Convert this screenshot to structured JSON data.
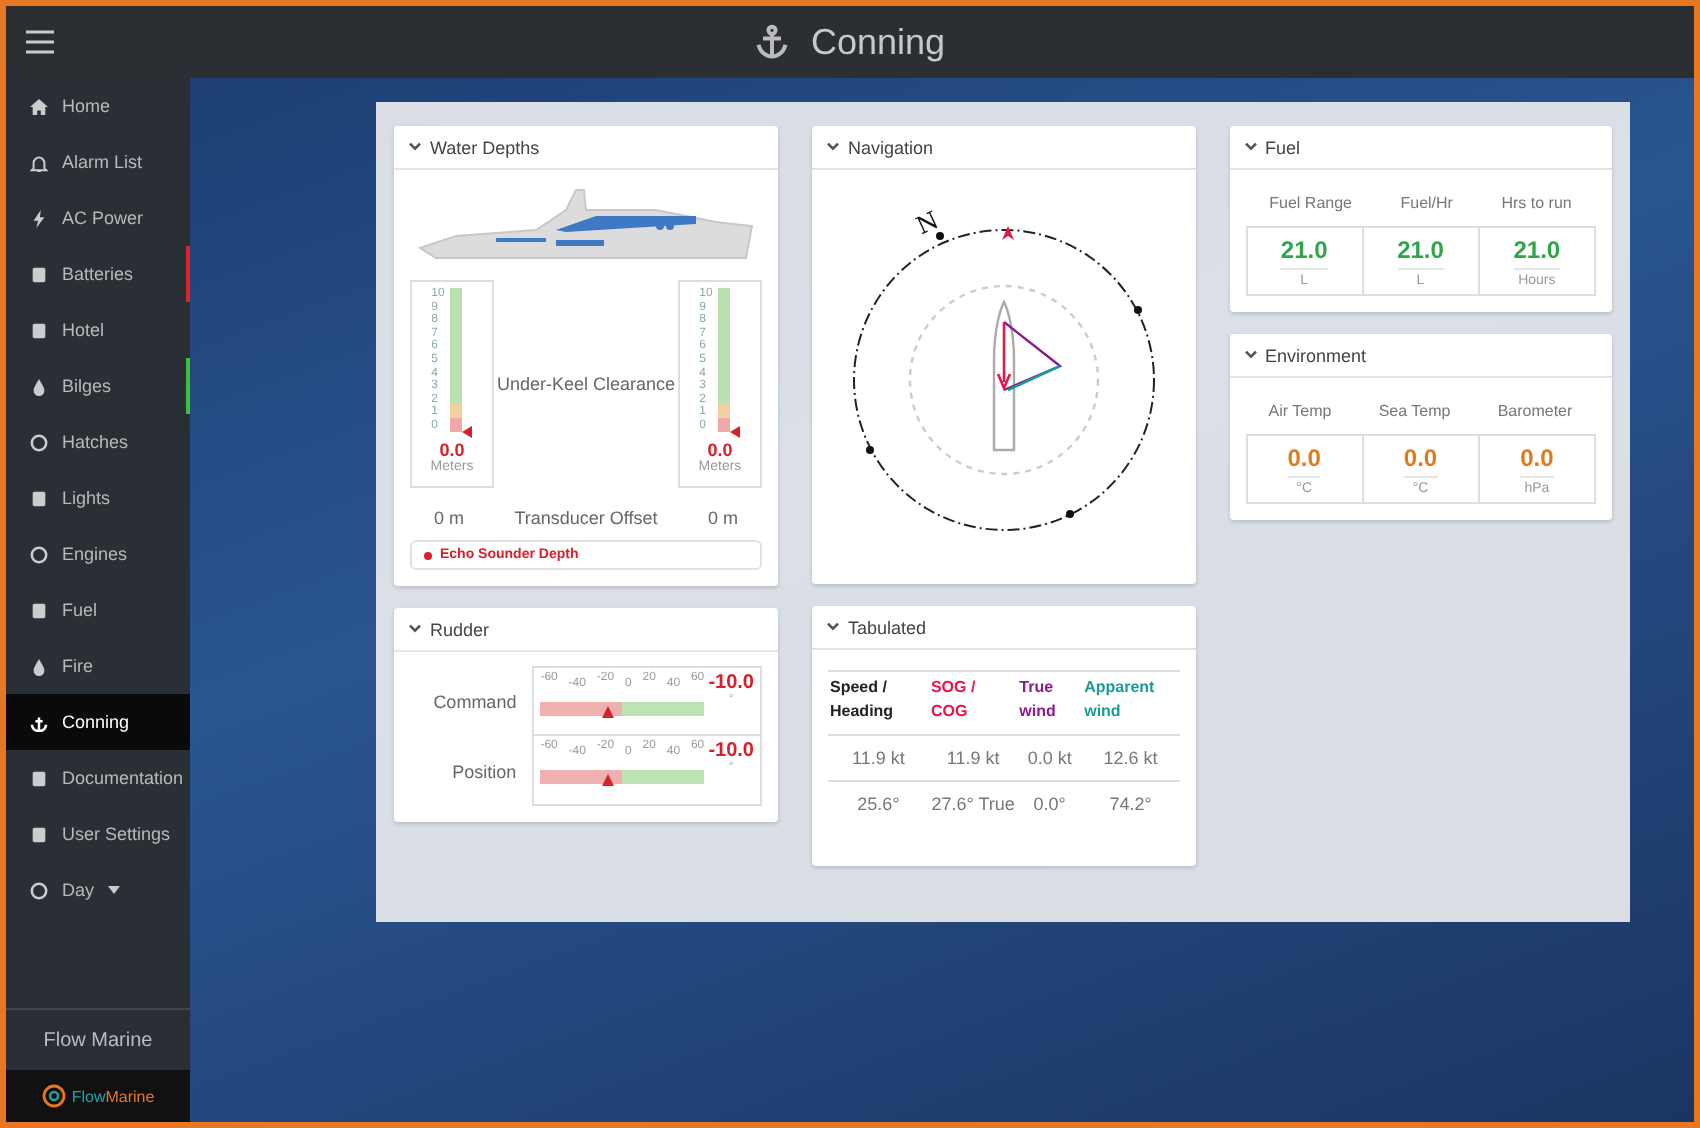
{
  "window": {
    "title": "Conning"
  },
  "sidebar": {
    "items": [
      {
        "label": "Home",
        "selected": false
      },
      {
        "label": "Alarm List",
        "selected": false
      },
      {
        "label": "AC Power",
        "selected": false
      },
      {
        "label": "Batteries",
        "selected": false,
        "color": "#e0202a"
      },
      {
        "label": "Hotel",
        "selected": false
      },
      {
        "label": "Bilges",
        "selected": false,
        "color": "#39c13a"
      },
      {
        "label": "Hatches",
        "selected": false
      },
      {
        "label": "Lights",
        "selected": false
      },
      {
        "label": "Engines",
        "selected": false
      },
      {
        "label": "Fuel",
        "selected": false
      },
      {
        "label": "Fire",
        "selected": false
      },
      {
        "label": "Conning",
        "selected": true
      },
      {
        "label": "Documentation",
        "selected": false
      },
      {
        "label": "User Settings",
        "selected": false
      },
      {
        "label": "Day",
        "selected": false,
        "dropdown": true
      }
    ],
    "footer": "Flow Marine",
    "logo": [
      {
        "text": "Flow",
        "color": "#1fa3a8"
      },
      {
        "text": "Marine",
        "color": "#e87722"
      }
    ]
  },
  "water_depths": {
    "title": "Water Depths",
    "center_label": "Under-Keel Clearance",
    "gauges": [
      {
        "scale": [
          "10",
          "9",
          "8",
          "7",
          "6",
          "5",
          "4",
          "3",
          "2",
          "1",
          "0"
        ],
        "level": 0,
        "value": "0.0",
        "unit": "Meters"
      },
      {
        "scale": [
          "10",
          "9",
          "8",
          "7",
          "6",
          "5",
          "4",
          "3",
          "2",
          "1",
          "0"
        ],
        "level": 0,
        "value": "0.0",
        "unit": "Meters"
      }
    ],
    "offset": {
      "left": "0 m",
      "label": "Transducer Offset",
      "right": "0 m"
    },
    "legend": {
      "label": "Echo Sounder Depth",
      "color": "#d8202a"
    }
  },
  "rudder": {
    "title": "Rudder",
    "rows": [
      {
        "label": "Command",
        "ticks": [
          "-60",
          "-40",
          "-20",
          "0",
          "20",
          "40",
          "60"
        ],
        "level": 0.4167,
        "value": "-10.0",
        "unit": "°"
      },
      {
        "label": "Position",
        "ticks": [
          "-60",
          "-40",
          "-20",
          "0",
          "20",
          "40",
          "60"
        ],
        "level": 0.4167,
        "value": "-10.0",
        "unit": "°"
      }
    ]
  },
  "navigation": {
    "title": "Navigation",
    "north_label": "N"
  },
  "tabulated": {
    "title": "Tabulated",
    "columns": [
      {
        "label": "Speed / Heading",
        "color": "#222222"
      },
      {
        "label": "SOG / COG",
        "color": "#e8174a"
      },
      {
        "label": "True wind",
        "color": "#8a1a8e"
      },
      {
        "label": "Apparent wind",
        "color": "#1a9b96"
      }
    ],
    "rows": [
      [
        "11.9 kt",
        "11.9 kt",
        "0.0 kt",
        "12.6 kt"
      ],
      [
        "25.6°",
        "27.6° True",
        "0.0°",
        "74.2°"
      ]
    ]
  },
  "fuel": {
    "title": "Fuel",
    "metrics": [
      {
        "label": "Fuel Range",
        "value": "21.0",
        "unit": "L",
        "color": "#2fa64a"
      },
      {
        "label": "Fuel/Hr",
        "value": "21.0",
        "unit": "L",
        "color": "#2fa64a"
      },
      {
        "label": "Hrs to run",
        "value": "21.0",
        "unit": "Hours",
        "color": "#2fa64a"
      }
    ]
  },
  "environment": {
    "title": "Environment",
    "metrics": [
      {
        "label": "Air Temp",
        "value": "0.0",
        "unit": "°C",
        "color": "#e07a1f"
      },
      {
        "label": "Sea Temp",
        "value": "0.0",
        "unit": "°C",
        "color": "#e07a1f"
      },
      {
        "label": "Barometer",
        "value": "0.0",
        "unit": "hPa",
        "color": "#e07a1f"
      }
    ]
  }
}
